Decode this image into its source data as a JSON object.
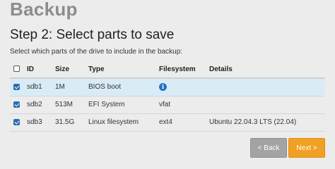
{
  "app_title": "Backup",
  "step_title": "Step 2: Select parts to save",
  "instructions": "Select which parts of the drive to include in the backup:",
  "table": {
    "select_all_checked": false,
    "headers": [
      "ID",
      "Size",
      "Type",
      "Filesystem",
      "Details"
    ],
    "rows": [
      {
        "checked": true,
        "selected": true,
        "id": "sdb1",
        "size": "1M",
        "type": "BIOS boot",
        "filesystem": "",
        "filesystem_icon": "info-icon",
        "details": ""
      },
      {
        "checked": true,
        "selected": false,
        "id": "sdb2",
        "size": "513M",
        "type": "EFI System",
        "filesystem": "vfat",
        "details": ""
      },
      {
        "checked": true,
        "selected": false,
        "id": "sdb3",
        "size": "31.5G",
        "type": "Linux filesystem",
        "filesystem": "ext4",
        "details": "Ubuntu 22.04.3 LTS (22.04)"
      }
    ]
  },
  "buttons": {
    "back": "< Back",
    "next": "Next >"
  },
  "colors": {
    "selected_row": "#d9ebf6",
    "next_button": "#f0a022",
    "back_button": "#a3a3a3",
    "checkbox": "#2a6db0",
    "info_icon": "#1f73c4"
  }
}
